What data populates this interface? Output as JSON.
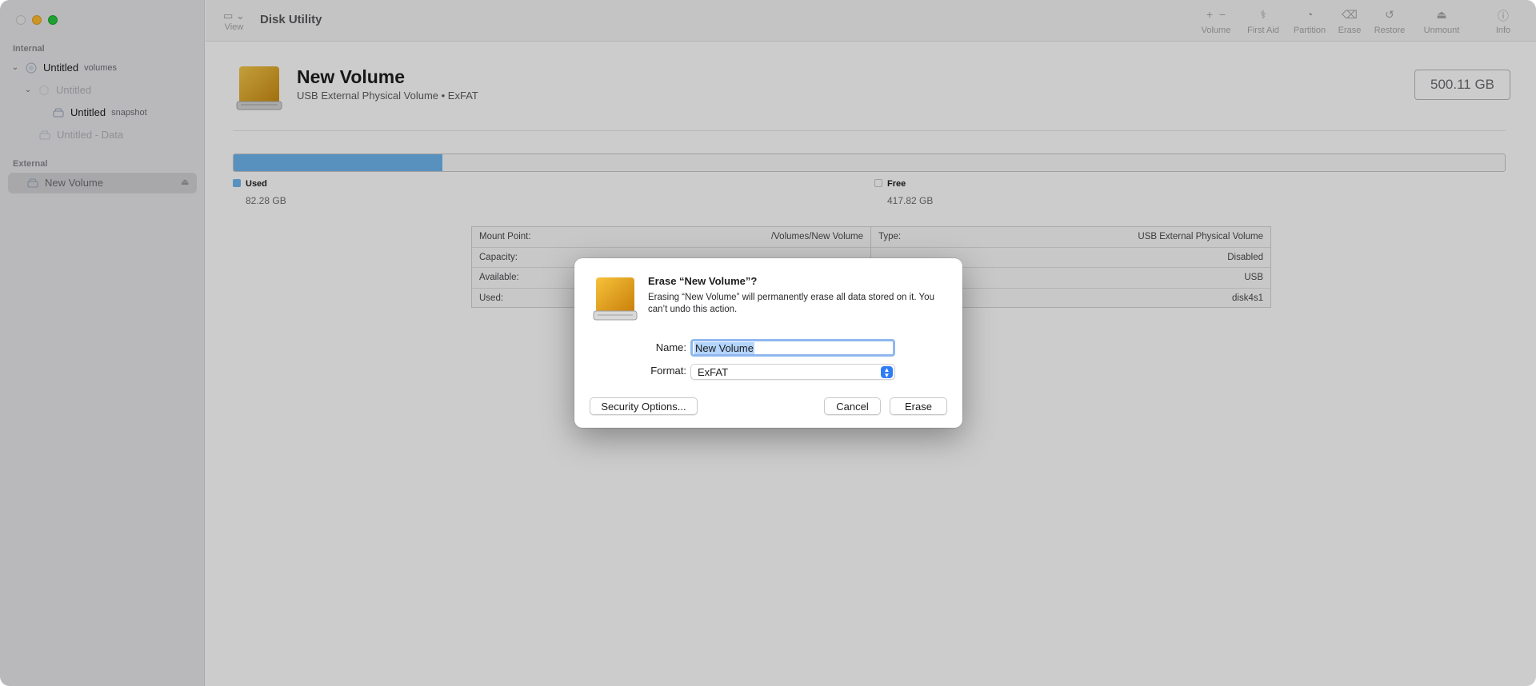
{
  "window": {
    "title": "Disk Utility"
  },
  "toolbar": {
    "view_label": "View",
    "actions": [
      {
        "label": "Volume",
        "icon": "plus-minus-icon"
      },
      {
        "label": "First Aid",
        "icon": "stethoscope-icon"
      },
      {
        "label": "Partition",
        "icon": "pie-icon"
      },
      {
        "label": "Erase",
        "icon": "erase-icon"
      },
      {
        "label": "Restore",
        "icon": "restore-icon"
      },
      {
        "label": "Unmount",
        "icon": "eject-icon"
      },
      {
        "label": "Info",
        "icon": "info-icon"
      }
    ]
  },
  "sidebar": {
    "internal_label": "Internal",
    "external_label": "External",
    "items": [
      {
        "label": "Untitled",
        "sub": "volumes"
      },
      {
        "label": "Untitled",
        "sub": ""
      },
      {
        "label": "Untitled",
        "sub": "snapshot"
      },
      {
        "label": "Untitled - Data",
        "sub": ""
      },
      {
        "label": "New Volume",
        "sub": ""
      }
    ]
  },
  "volume": {
    "name": "New Volume",
    "subtitle": "USB External Physical Volume • ExFAT",
    "size": "500.11 GB",
    "used_fraction": 0.1645,
    "used_label": "Used",
    "used_value": "82.28 GB",
    "free_label": "Free",
    "free_value": "417.82 GB",
    "info_left": [
      {
        "key": "Mount Point:",
        "value": "/Volumes/New Volume"
      },
      {
        "key": "Capacity:",
        "value": ""
      },
      {
        "key": "Available:",
        "value": ""
      },
      {
        "key": "Used:",
        "value": ""
      }
    ],
    "info_right": [
      {
        "key": "Type:",
        "value": "USB External Physical Volume"
      },
      {
        "key": "",
        "value": "Disabled"
      },
      {
        "key": "",
        "value": "USB"
      },
      {
        "key": "",
        "value": "disk4s1"
      }
    ]
  },
  "dialog": {
    "title": "Erase “New Volume”?",
    "message": "Erasing “New Volume” will permanently erase all data stored on it. You can’t undo this action.",
    "name_label": "Name:",
    "name_value": "New Volume",
    "format_label": "Format:",
    "format_value": "ExFAT",
    "security_button": "Security Options...",
    "cancel_button": "Cancel",
    "erase_button": "Erase"
  },
  "colors": {
    "used": "#6fb6ee",
    "accent": "#2f7df6",
    "sidebar_bg": "#e8e6ea"
  }
}
